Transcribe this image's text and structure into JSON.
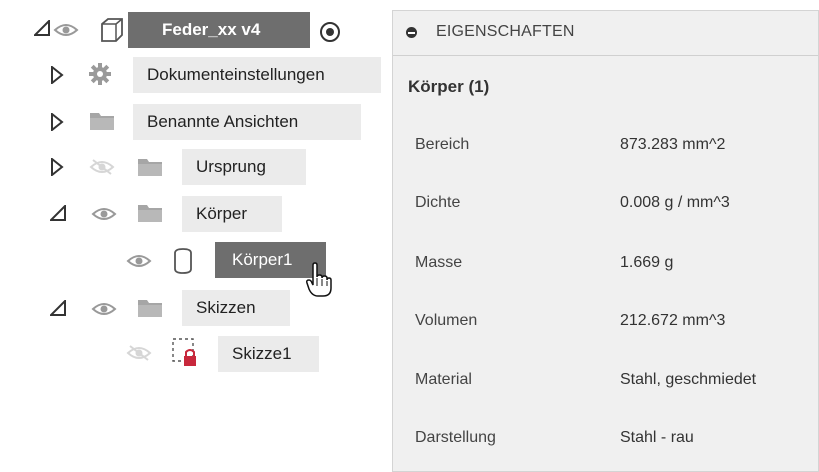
{
  "browser": {
    "root": {
      "label": "Feder_xx v4"
    },
    "items": [
      {
        "label": "Dokumenteinstellungen"
      },
      {
        "label": "Benannte Ansichten"
      },
      {
        "label": "Ursprung"
      },
      {
        "label": "Körper"
      },
      {
        "label": "Körper1"
      },
      {
        "label": "Skizzen"
      },
      {
        "label": "Skizze1"
      }
    ]
  },
  "properties": {
    "header": "EIGENSCHAFTEN",
    "heading": "Körper (1)",
    "rows": [
      {
        "name": "Bereich",
        "value": "873.283 mm^2"
      },
      {
        "name": "Dichte",
        "value": "0.008 g / mm^3"
      },
      {
        "name": "Masse",
        "value": "1.669 g"
      },
      {
        "name": "Volumen",
        "value": "212.672 mm^3"
      },
      {
        "name": "Material",
        "value": "Stahl, geschmiedet"
      },
      {
        "name": "Darstellung",
        "value": "Stahl - rau"
      }
    ]
  },
  "colors": {
    "selected_bg": "#6e6e6e",
    "row_bg": "#ebebeb",
    "panel_bg": "#f0f0f0",
    "lock_red": "#c8283c"
  }
}
